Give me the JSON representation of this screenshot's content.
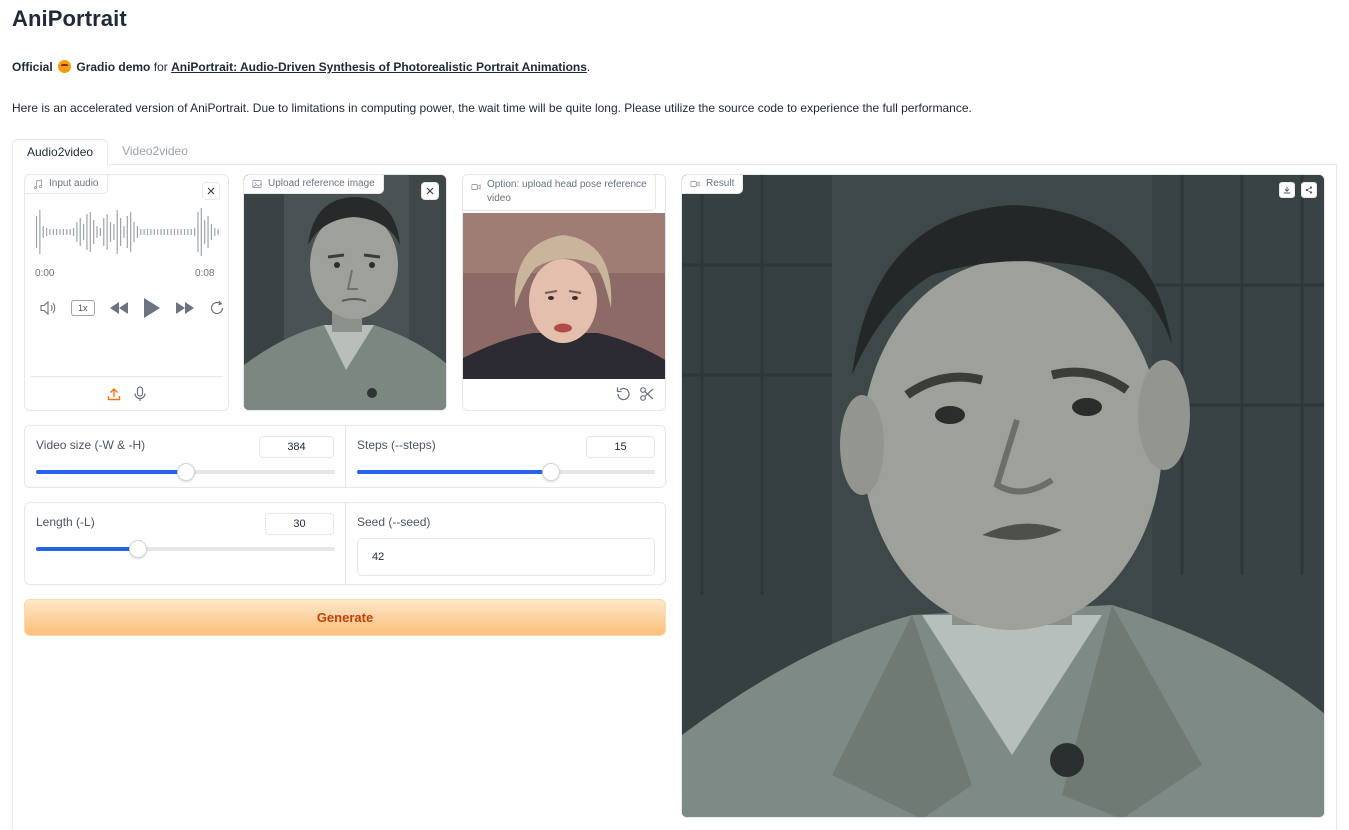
{
  "app": {
    "title": "AniPortrait",
    "intro_official": "Official",
    "intro_gradio": "Gradio demo",
    "intro_for": "for",
    "intro_link": "AniPortrait: Audio-Driven Synthesis of Photorealistic Portrait Animations",
    "intro_end": ".",
    "description": "Here is an accelerated version of AniPortrait. Due to limitations in computing power, the wait time will be quite long. Please utilize the source code to experience the full performance."
  },
  "tabs": [
    {
      "label": "Audio2video",
      "active": true
    },
    {
      "label": "Video2video",
      "active": false
    }
  ],
  "audio": {
    "label": "Input audio",
    "time_start": "0:00",
    "time_end": "0:08",
    "speed": "1x"
  },
  "reference_image": {
    "label": "Upload reference image"
  },
  "pose_video": {
    "label_line1": "Option: upload head pose reference",
    "label_line2": "video"
  },
  "result": {
    "label": "Result"
  },
  "params": {
    "video_size": {
      "label": "Video size (-W & -H)",
      "value": "384",
      "fraction": 0.5
    },
    "steps": {
      "label": "Steps (--steps)",
      "value": "15",
      "fraction": 0.65
    },
    "length": {
      "label": "Length (-L)",
      "value": "30",
      "fraction": 0.34
    },
    "seed": {
      "label": "Seed (--seed)",
      "value": "42"
    }
  },
  "generate_label": "Generate",
  "colors": {
    "accent": "#2563eb",
    "generate_text": "#c2410c",
    "generate_bg": "#fbbf7a"
  }
}
